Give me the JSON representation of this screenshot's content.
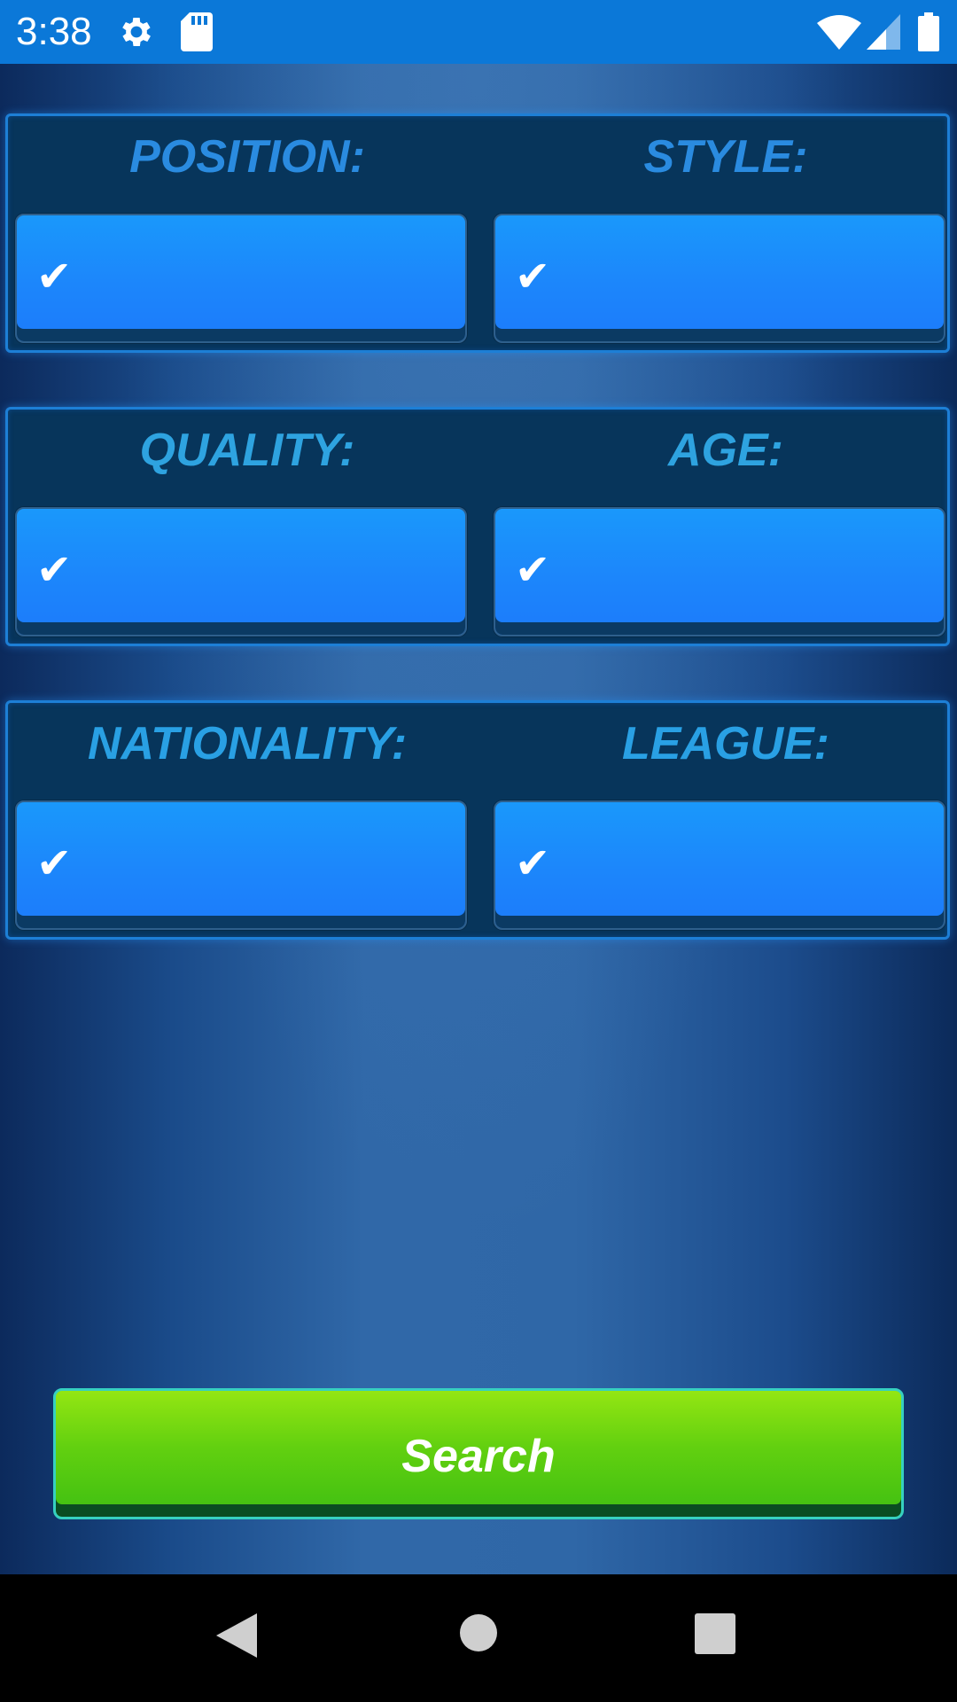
{
  "status_bar": {
    "time": "3:38",
    "icons": [
      "gear-icon",
      "sd-card-icon",
      "wifi-icon",
      "cell-signal-icon",
      "battery-icon"
    ]
  },
  "filters": [
    {
      "left": {
        "label": "POSITION:",
        "check": "✔"
      },
      "right": {
        "label": "STYLE:",
        "check": "✔"
      }
    },
    {
      "left": {
        "label": "QUALITY:",
        "check": "✔"
      },
      "right": {
        "label": "AGE:",
        "check": "✔"
      }
    },
    {
      "left": {
        "label": "NATIONALITY:",
        "check": "✔"
      },
      "right": {
        "label": "LEAGUE:",
        "check": "✔"
      }
    }
  ],
  "search_button": {
    "label": "Search"
  },
  "nav_bar": {
    "icons": [
      "back-icon",
      "home-icon",
      "recents-icon"
    ]
  },
  "colors": {
    "status_bar": "#0b78d8",
    "panel_bg": "#07355b",
    "panel_border": "#1d7fd6",
    "select_button": "#1c86fb",
    "search_button": "#62d010"
  }
}
